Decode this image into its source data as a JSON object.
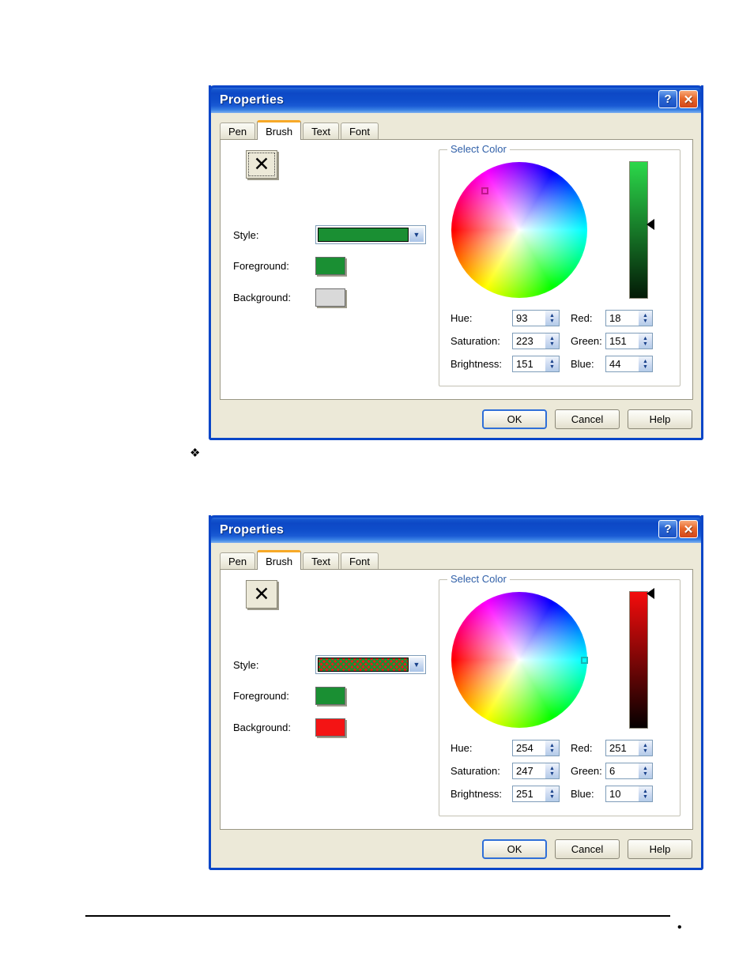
{
  "page": {
    "bullet_symbol": "❖",
    "footer_dot": "•"
  },
  "dialogs": [
    {
      "title": "Properties",
      "titlebar": {
        "help_label": "?",
        "close_label": "✕"
      },
      "tabs": [
        {
          "label": "Pen",
          "active": false
        },
        {
          "label": "Brush",
          "active": true
        },
        {
          "label": "Text",
          "active": false
        },
        {
          "label": "Font",
          "active": false
        }
      ],
      "preview": {
        "glyph": "✕",
        "focused": true
      },
      "fields": {
        "style_label": "Style:",
        "foreground_label": "Foreground:",
        "background_label": "Background:",
        "style_fill": "#1a8f33",
        "foreground_color": "#1a8f33",
        "background_color": "#d9d9d9",
        "dropdown_arrow": "▼"
      },
      "select_color": {
        "legend": "Select Color",
        "slider_top_color": "#2bd84a",
        "slider_bottom_color": "#031a06",
        "slider_thumb_pos_pct": 46,
        "cursor_x_pct": 25,
        "cursor_y_pct": 21,
        "cursor_color": "#c0168c",
        "values": [
          {
            "label": "Hue:",
            "value": "93"
          },
          {
            "label": "Saturation:",
            "value": "223"
          },
          {
            "label": "Brightness:",
            "value": "151"
          },
          {
            "label": "Red:",
            "value": "18"
          },
          {
            "label": "Green:",
            "value": "151"
          },
          {
            "label": "Blue:",
            "value": "44"
          }
        ],
        "spin_up": "▲",
        "spin_down": "▼"
      },
      "buttons": [
        {
          "label": "OK",
          "default": true
        },
        {
          "label": "Cancel",
          "default": false
        },
        {
          "label": "Help",
          "default": false
        }
      ]
    },
    {
      "title": "Properties",
      "titlebar": {
        "help_label": "?",
        "close_label": "✕"
      },
      "tabs": [
        {
          "label": "Pen",
          "active": false
        },
        {
          "label": "Brush",
          "active": true
        },
        {
          "label": "Text",
          "active": false
        },
        {
          "label": "Font",
          "active": false
        }
      ],
      "preview": {
        "glyph": "✕",
        "focused": false
      },
      "fields": {
        "style_label": "Style:",
        "foreground_label": "Foreground:",
        "background_label": "Background:",
        "style_fill": "#e81a1a",
        "style_pattern_color": "#1a8f33",
        "foreground_color": "#1a8f33",
        "background_color": "#f41414",
        "dropdown_arrow": "▼"
      },
      "select_color": {
        "legend": "Select Color",
        "slider_top_color": "#f40c0c",
        "slider_bottom_color": "#050000",
        "slider_thumb_pos_pct": 2,
        "cursor_x_pct": 98,
        "cursor_y_pct": 50,
        "cursor_color": "#16b6b6",
        "values": [
          {
            "label": "Hue:",
            "value": "254"
          },
          {
            "label": "Saturation:",
            "value": "247"
          },
          {
            "label": "Brightness:",
            "value": "251"
          },
          {
            "label": "Red:",
            "value": "251"
          },
          {
            "label": "Green:",
            "value": "6"
          },
          {
            "label": "Blue:",
            "value": "10"
          }
        ],
        "spin_up": "▲",
        "spin_down": "▼"
      },
      "buttons": [
        {
          "label": "OK",
          "default": true
        },
        {
          "label": "Cancel",
          "default": false
        },
        {
          "label": "Help",
          "default": false
        }
      ]
    }
  ]
}
